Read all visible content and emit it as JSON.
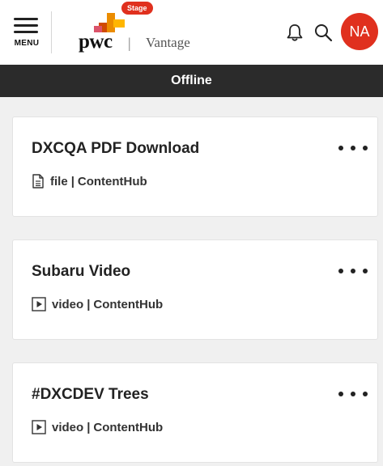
{
  "header": {
    "menu_label": "MENU",
    "logo_text": "pwc",
    "separator": "|",
    "app_name": "Vantage",
    "env_badge": "Stage",
    "avatar_initials": "NA",
    "icons": [
      "menu-icon",
      "bell-icon",
      "search-icon"
    ]
  },
  "status_bar": {
    "text": "Offline"
  },
  "items": [
    {
      "title": "DXCQA PDF Download",
      "type": "file",
      "separator": "|",
      "source": "ContentHub",
      "icon": "file-icon"
    },
    {
      "title": "Subaru Video",
      "type": "video",
      "separator": "|",
      "source": "ContentHub",
      "icon": "video-icon"
    },
    {
      "title": "#DXCDEV Trees",
      "type": "video",
      "separator": "|",
      "source": "ContentHub",
      "icon": "video-icon"
    }
  ],
  "colors": {
    "brand_red": "#e0301e",
    "brand_orange": "#eb8c00",
    "status_bar_bg": "#2b2b2b",
    "page_bg": "#f0f0f0"
  }
}
